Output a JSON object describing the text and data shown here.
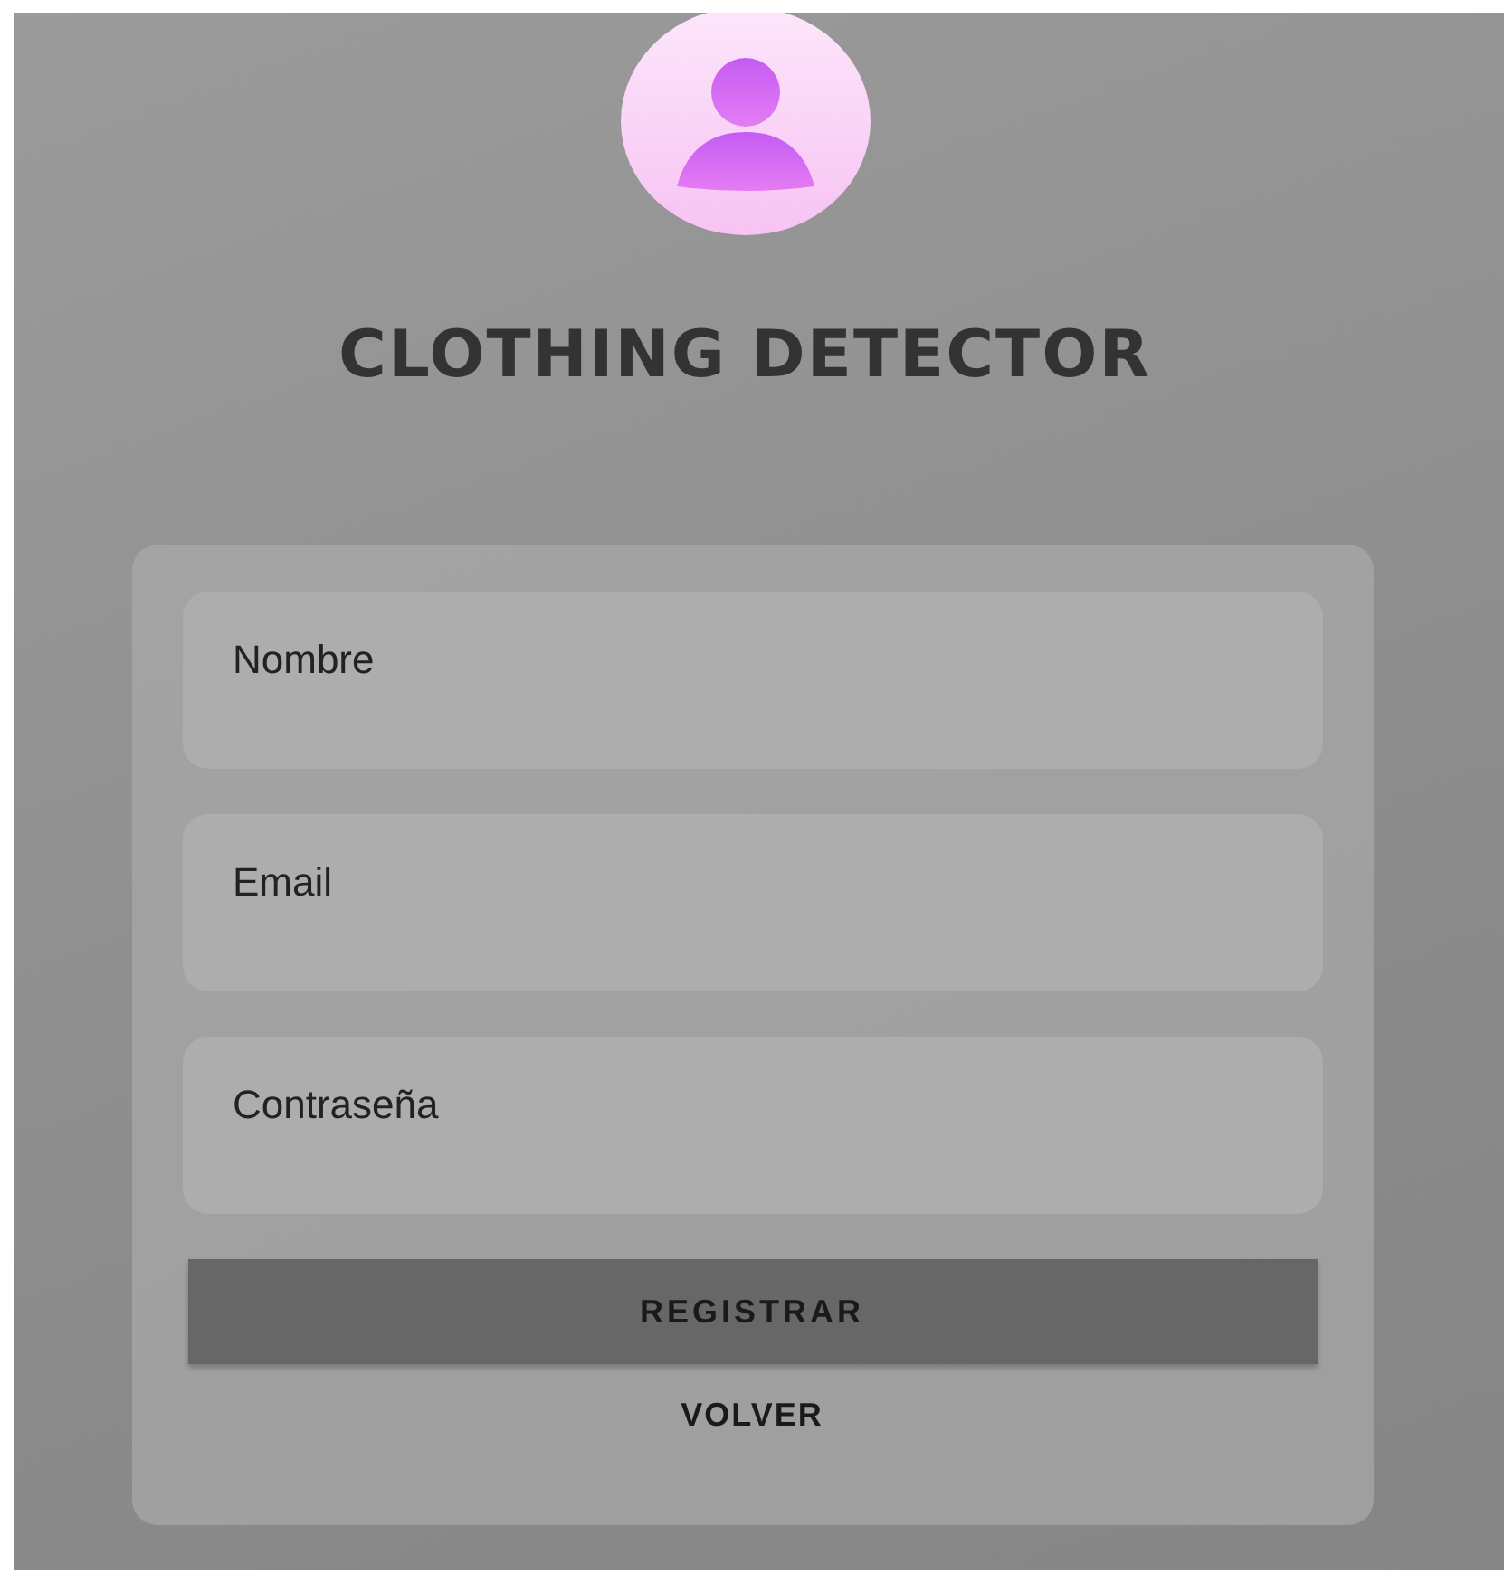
{
  "title": "CLOTHING DETECTOR",
  "fields": [
    {
      "placeholder": "Nombre"
    },
    {
      "placeholder": "Email"
    },
    {
      "placeholder": "Contraseña"
    }
  ],
  "submit_button": "REGISTRAR",
  "back_link": "VOLVER"
}
